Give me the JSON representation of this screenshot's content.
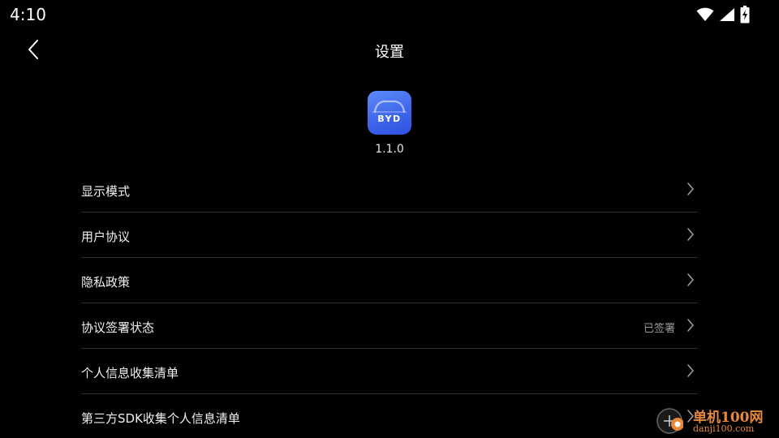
{
  "status_bar": {
    "time": "4:10",
    "icons": [
      "wifi-icon",
      "cellular-signal-icon",
      "battery-charging-icon"
    ]
  },
  "header": {
    "title": "设置",
    "back_icon": "chevron-left-icon"
  },
  "app": {
    "logo_text": "BYD",
    "version": "1.1.0",
    "logo_colors": [
      "#5d8cf8",
      "#2e52e0"
    ]
  },
  "settings": {
    "items": [
      {
        "label": "显示模式",
        "value": ""
      },
      {
        "label": "用户协议",
        "value": ""
      },
      {
        "label": "隐私政策",
        "value": ""
      },
      {
        "label": "协议签署状态",
        "value": "已签署"
      },
      {
        "label": "个人信息收集清单",
        "value": ""
      },
      {
        "label": "第三方SDK收集个人信息清单",
        "value": ""
      }
    ]
  },
  "watermark": {
    "name": "单机100网",
    "url": "danji100.com"
  },
  "colors": {
    "background": "#000000",
    "divider": "#2e2e2e",
    "secondary_text": "#9a9a9a",
    "watermark": "#e8893a"
  }
}
